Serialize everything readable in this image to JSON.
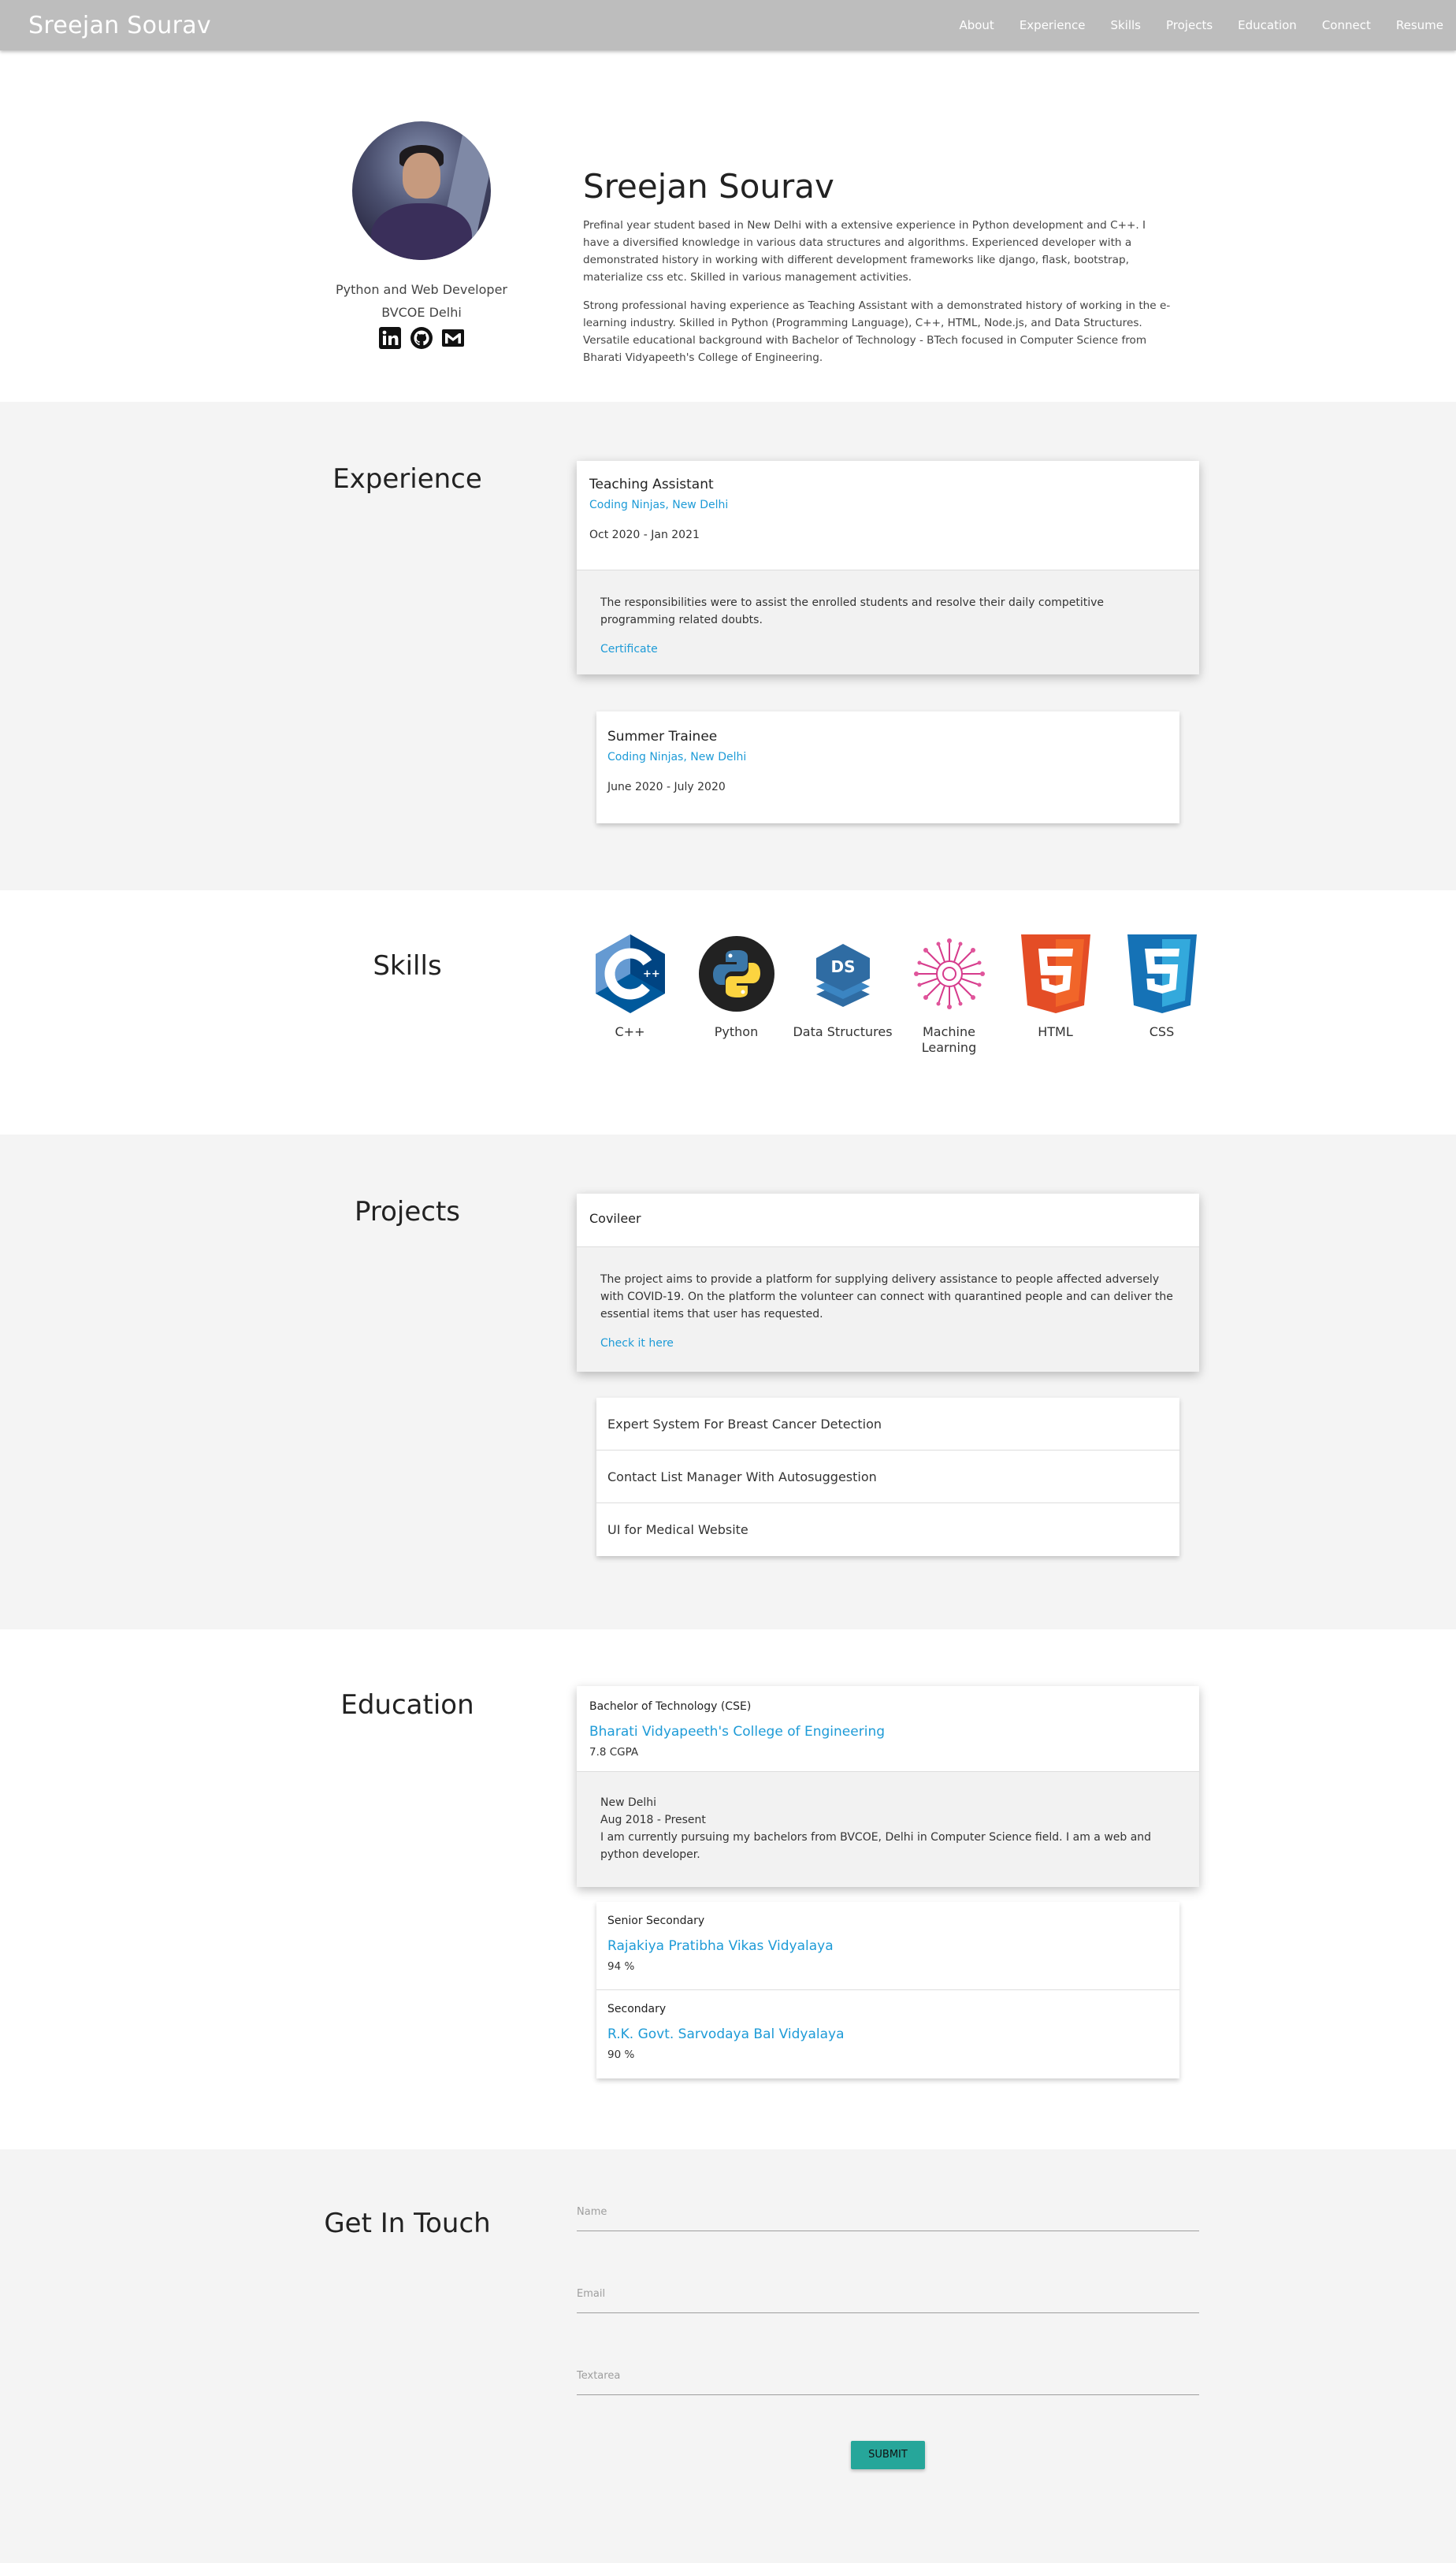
{
  "nav": {
    "brand": "Sreejan Sourav",
    "links": [
      "About",
      "Experience",
      "Skills",
      "Projects",
      "Education",
      "Connect",
      "Resume"
    ]
  },
  "hero": {
    "role": "Python and Web Developer",
    "college": "BVCOE Delhi",
    "name": "Sreejan Sourav",
    "para1": "Prefinal year student based in New Delhi with a extensive experience in Python development and C++. I have a diversified knowledge in various data structures and algorithms. Experienced developer with a demonstrated history in working with different development frameworks like django, flask, bootstrap, materialize css etc. Skilled in various management activities.",
    "para2": "Strong professional having experience as Teaching Assistant with a demonstrated history of working in the e-learning industry. Skilled in Python (Programming Language), C++, HTML, Node.js, and Data Structures. Versatile educational background with Bachelor of Technology - BTech focused in Computer Science from Bharati Vidyapeeth's College of Engineering.",
    "social_icons": [
      "linkedin-icon",
      "github-icon",
      "mail-icon"
    ]
  },
  "experience": {
    "title": "Experience",
    "items": [
      {
        "title": "Teaching Assistant",
        "org": "Coding Ninjas, New Delhi",
        "date": "Oct 2020 - Jan 2021",
        "desc": "The responsibilities were to assist the enrolled students and resolve their daily competitive programming related doubts.",
        "link": "Certificate"
      },
      {
        "title": "Summer Trainee",
        "org": "Coding Ninjas, New Delhi",
        "date": "June 2020 - July 2020"
      }
    ]
  },
  "skills": {
    "title": "Skills",
    "items": [
      {
        "name": "C++",
        "icon": "cpp-icon"
      },
      {
        "name": "Python",
        "icon": "python-icon"
      },
      {
        "name": "Data Structures",
        "icon": "ds-icon"
      },
      {
        "name": "Machine Learning",
        "icon": "ml-icon"
      },
      {
        "name": "HTML",
        "icon": "html5-icon"
      },
      {
        "name": "CSS",
        "icon": "css3-icon"
      }
    ]
  },
  "projects": {
    "title": "Projects",
    "open": {
      "title": "Covileer",
      "desc": "The project aims to provide a platform for supplying delivery assistance to people affected adversely with COVID-19. On the platform the volunteer can connect with quarantined people and can deliver the essential items that user has requested.",
      "link": "Check it here"
    },
    "others": [
      "Expert System For Breast Cancer Detection",
      "Contact List Manager With Autosuggestion",
      "UI for Medical Website"
    ]
  },
  "education": {
    "title": "Education",
    "main": {
      "degree": "Bachelor of Technology (CSE)",
      "school": "Bharati Vidyapeeth's College of Engineering",
      "score": "7.8 CGPA",
      "location": "New Delhi",
      "date": "Aug 2018 - Present",
      "desc": "I am currently pursuing my bachelors from BVCOE, Delhi in Computer Science field. I am a web and python developer."
    },
    "others": [
      {
        "degree": "Senior Secondary",
        "school": "Rajakiya Pratibha Vikas Vidyalaya",
        "score": "94 %"
      },
      {
        "degree": "Secondary",
        "school": "R.K. Govt. Sarvodaya Bal Vidyalaya",
        "score": "90 %"
      }
    ]
  },
  "contact": {
    "title": "Get In Touch",
    "name_placeholder": "Name",
    "email_placeholder": "Email",
    "textarea_placeholder": "Textarea",
    "submit": "SUBMIT"
  },
  "colors": {
    "nav_bg": "#bdbdbd",
    "link": "#1e9bd7",
    "submit": "#26a69a",
    "section_gray": "#f4f4f4"
  }
}
